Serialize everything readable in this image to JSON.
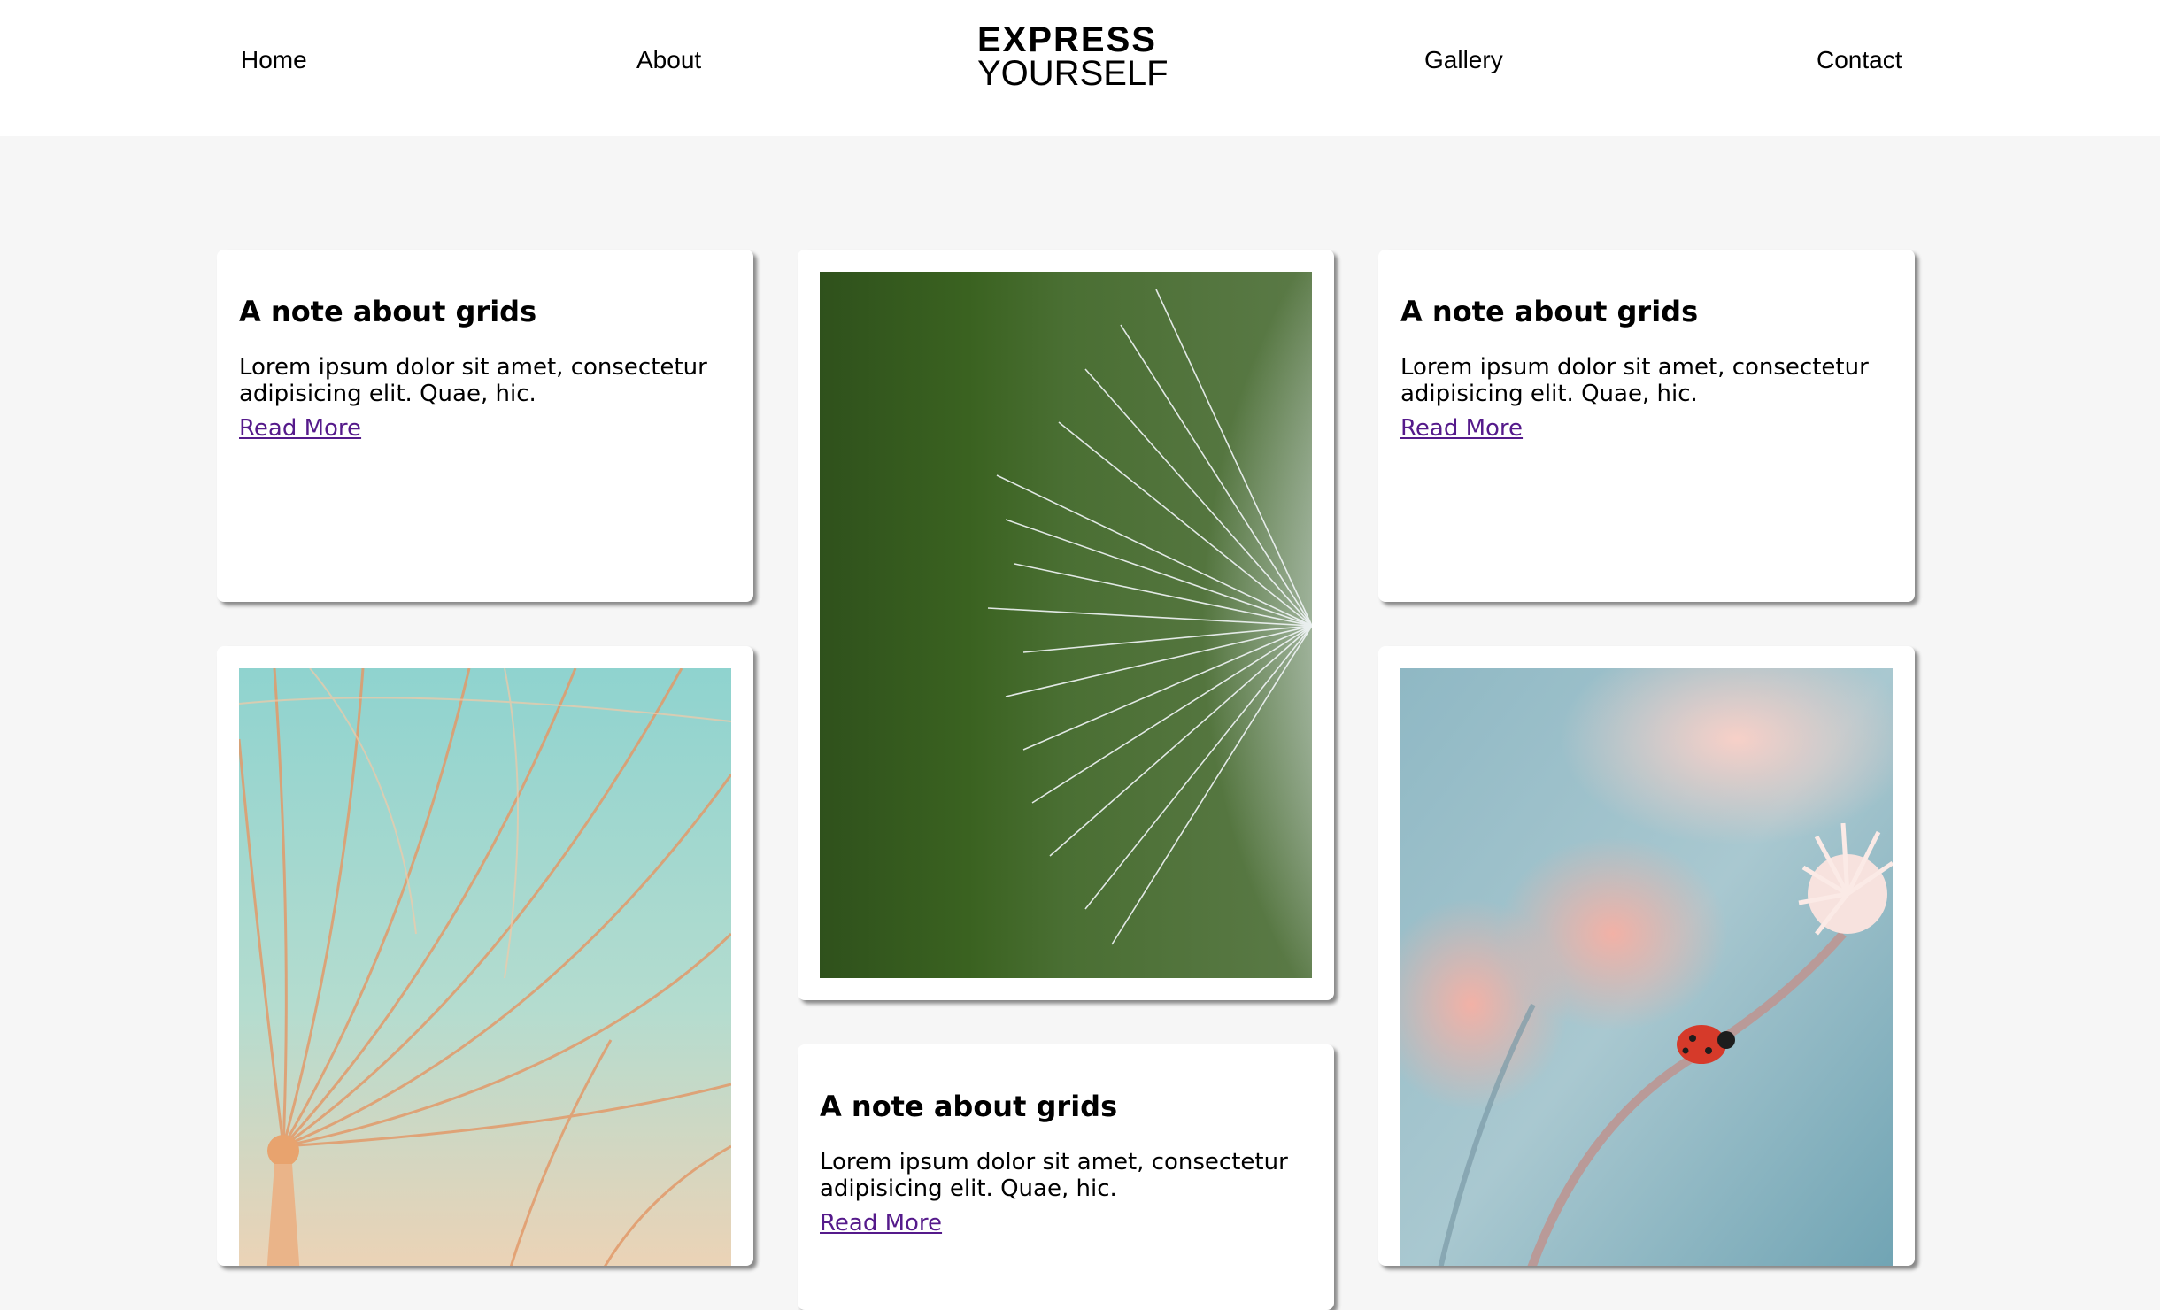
{
  "nav": {
    "home": "Home",
    "about": "About",
    "gallery": "Gallery",
    "contact": "Contact"
  },
  "brand": {
    "line1": "EXPRESS",
    "line2": "YOURSELF"
  },
  "cards": [
    {
      "title": "A note about grids",
      "body": "Lorem ipsum dolor sit amet, consectetur adipisicing elit. Quae, hic.",
      "link": "Read More"
    },
    {
      "title": "A note about grids",
      "body": "Lorem ipsum dolor sit amet, consectetur adipisicing elit. Quae, hic.",
      "link": "Read More"
    },
    {
      "title": "A note about grids",
      "body": "Lorem ipsum dolor sit amet, consectetur adipisicing elit. Quae, hic.",
      "link": "Read More"
    }
  ],
  "photos": [
    {
      "subject": "dandelion-seed-head-on-green"
    },
    {
      "subject": "dandelion-seeds-with-dew-on-teal"
    },
    {
      "subject": "ladybug-on-pink-flower-stem"
    }
  ],
  "colors": {
    "page_bg": "#f6f6f6",
    "nav_bg": "#ffffff",
    "card_bg": "#ffffff",
    "link_visited": "#551a8b"
  }
}
